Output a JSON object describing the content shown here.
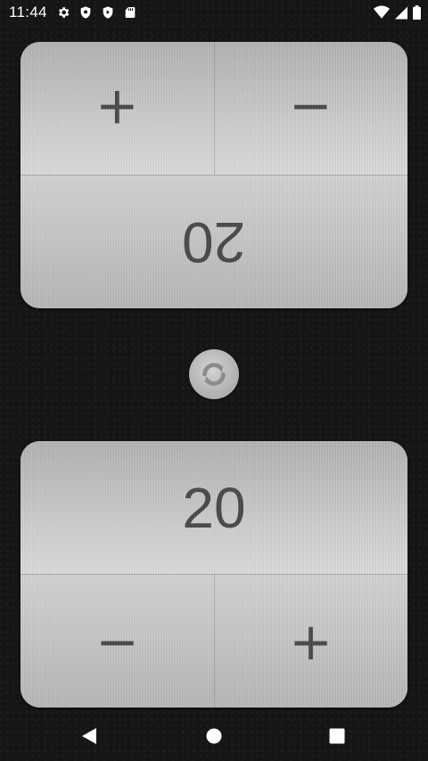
{
  "status_bar": {
    "time": "11:44",
    "left_icons": [
      "settings-icon",
      "shield-icon",
      "play-protect-icon",
      "sd-card-icon"
    ],
    "right_icons": [
      "wifi-icon",
      "cellular-signal-icon",
      "battery-icon"
    ]
  },
  "top_player": {
    "increment_label": "+",
    "decrement_label": "−",
    "score": "20",
    "orientation": "rotated-180"
  },
  "bottom_player": {
    "increment_label": "+",
    "decrement_label": "−",
    "score": "20"
  },
  "swap_button": {
    "icon": "refresh-icon"
  },
  "nav_bar": {
    "icons": [
      "back-icon",
      "home-icon",
      "recents-icon"
    ]
  },
  "colors": {
    "background": "#151515",
    "panel_metal": "#c8c8c8",
    "text": "#4a4a4a"
  }
}
